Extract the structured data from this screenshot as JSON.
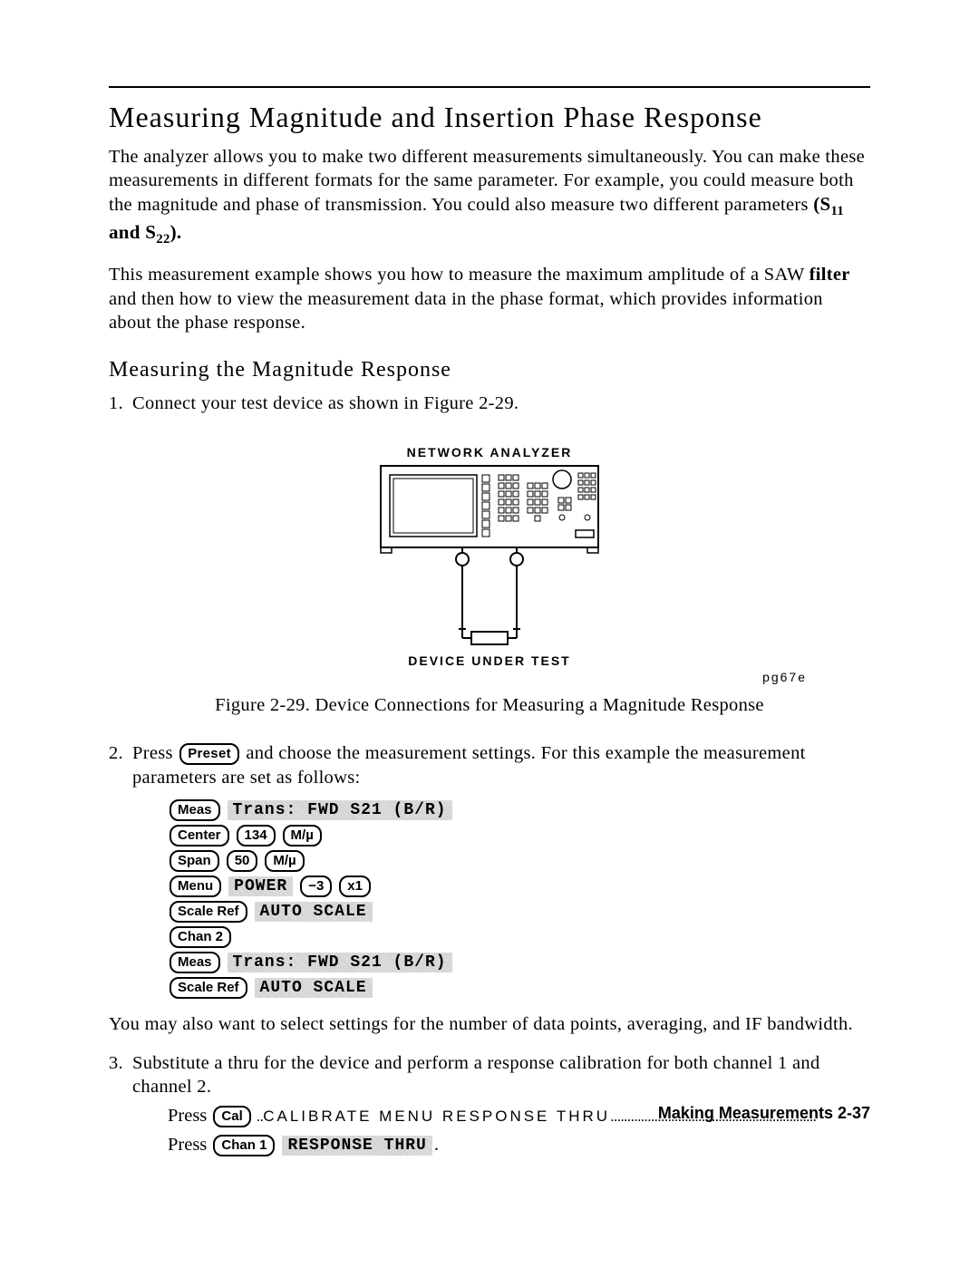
{
  "title": "Measuring Magnitude and Insertion Phase Response",
  "para1_a": "The analyzer allows you to make two different measurements simultaneously. You can make these measurements in different formats for the same parameter. For example, you could measure both the magnitude and phase of transmission. You could also measure two different parameters ",
  "params": "(S",
  "params_sub1": "11",
  "params_mid": " and S",
  "params_sub2": "22",
  "params_end": ").",
  "para2_a": "This measurement example shows you how to measure the maximum amplitude of a SAW ",
  "para2_filter": "filter",
  "para2_b": " and then how to view the measurement data in the phase format, which provides information about the phase response.",
  "sub1": "Measuring the Magnitude Response",
  "step1": "Connect your test device as shown in Figure 2-29.",
  "diagram": {
    "top_label": "NETWORK ANALYZER",
    "bottom_label": "DEVICE UNDER TEST",
    "tag": "pg67e"
  },
  "fig_caption": "Figure 2-29. Device Connections for Measuring a Magnitude Response",
  "step2_a": "Press ",
  "step2_key": "Preset",
  "step2_b": " and choose the measurement settings. For this example the measurement parameters are set as follows:",
  "seq": {
    "r1_k1": "Meas",
    "r1_s1": "Trans: FWD S21 (B/R)",
    "r2_k1": "Center",
    "r2_k2": "134",
    "r2_k3": "M/µ",
    "r3_k1": "Span",
    "r3_k2": "50",
    "r3_k3": "M/µ",
    "r4_k1": "Menu",
    "r4_s1": "POWER",
    "r4_k2": "−3",
    "r4_k3": "x1",
    "r5_k1": "Scale Ref",
    "r5_s1": "AUTO SCALE",
    "r6_k1": "Chan 2",
    "r7_k1": "Meas",
    "r7_s1": "Trans: FWD S21 (B/R)",
    "r8_k1": "Scale Ref",
    "r8_s1": "AUTO SCALE"
  },
  "step2_after": "You may also want to select settings for the number of data points, averaging, and IF bandwidth.",
  "step3": "Substitute a thru for the device and perform a response calibration for both channel 1 and channel 2.",
  "step3_line1_a": "Press ",
  "step3_line1_key": "Cal",
  "step3_line1_menu": "CALIBRATE MENU  RESPONSE THRU",
  "step3_line2_a": "Press ",
  "step3_line2_key": "Chan 1",
  "step3_line2_soft": "RESPONSE THRU",
  "step3_line2_end": ".",
  "footer": "Making Measurements  2-37"
}
